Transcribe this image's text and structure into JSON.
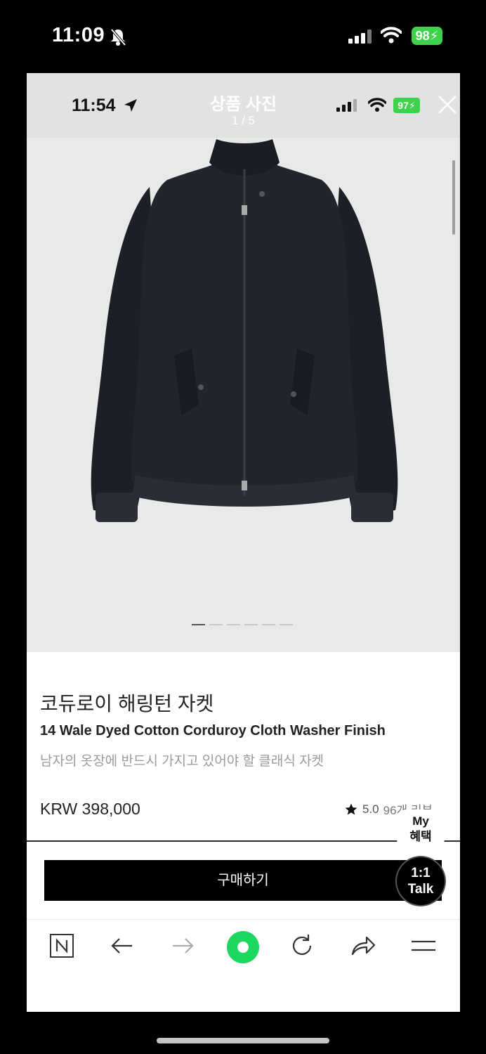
{
  "device_status": {
    "time": "11:09",
    "battery": "98"
  },
  "viewer": {
    "status_time": "11:54",
    "status_battery": "97",
    "title": "상품 사진",
    "counter": "1 / 5"
  },
  "product": {
    "name": "코듀로이 해링턴 자켓",
    "subtitle": "14 Wale Dyed Cotton Corduroy Cloth Washer Finish",
    "description": "남자의 옷장에 반드시 가지고 있어야 할 클래식 자켓",
    "price": "KRW 398,000",
    "rating": "5.0",
    "review_count": "96개 리뷰"
  },
  "actions": {
    "buy_label": "구매하기",
    "benefit_line1": "My",
    "benefit_line2": "혜택",
    "talk_line1": "1:1",
    "talk_line2": "Talk"
  },
  "toolbar": {
    "items": [
      "naver-home-icon",
      "back-arrow-icon",
      "forward-arrow-icon",
      "green-dot-icon",
      "refresh-icon",
      "share-icon",
      "menu-icon"
    ]
  },
  "colors": {
    "accent_green": "#1ed760",
    "battery_green": "#3ed14b"
  }
}
